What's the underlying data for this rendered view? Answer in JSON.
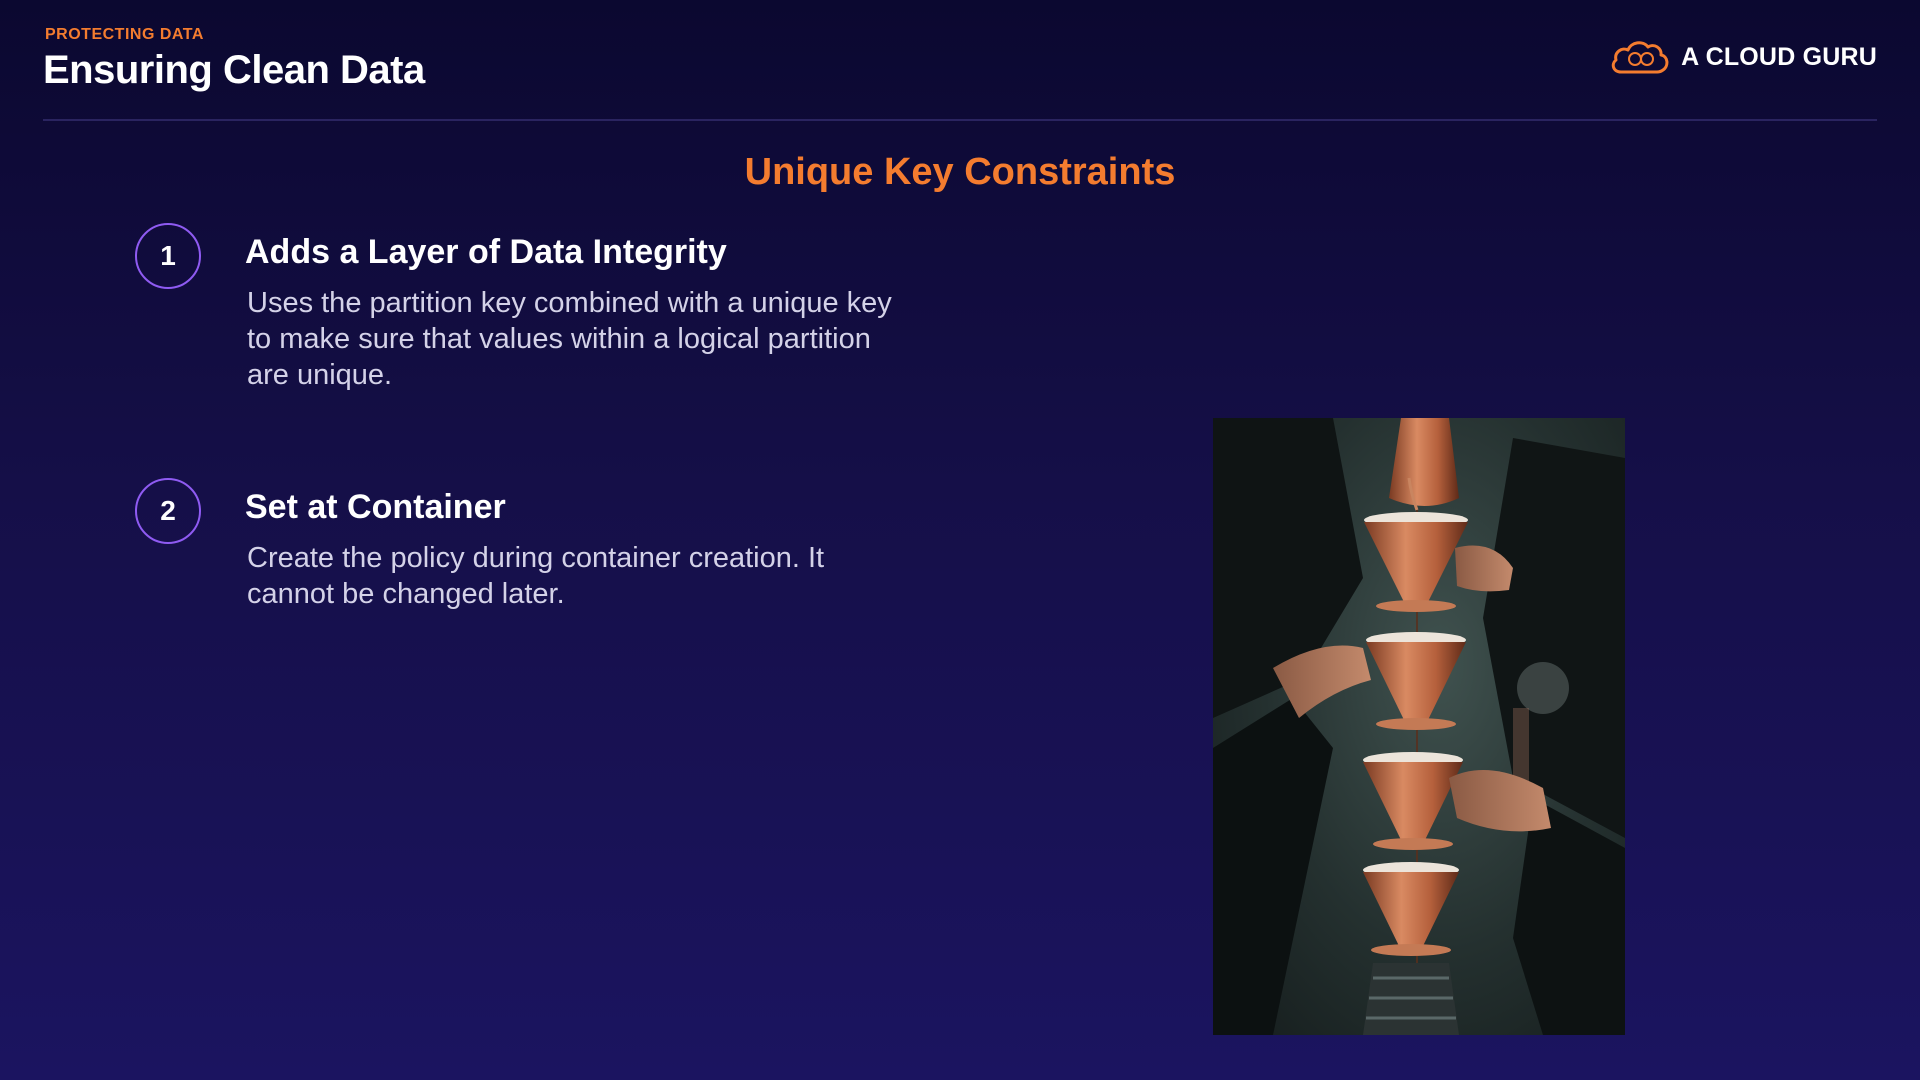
{
  "header": {
    "eyebrow": "PROTECTING DATA",
    "title": "Ensuring Clean Data"
  },
  "logo": {
    "icon": "cloud-icon",
    "text": "A CLOUD GURU"
  },
  "section_title": "Unique Key Constraints",
  "items": [
    {
      "number": "1",
      "heading": "Adds a Layer of Data Integrity",
      "body": "Uses the partition key combined with a unique key to make sure that values within a logical partition are unique."
    },
    {
      "number": "2",
      "heading": "Set at Container",
      "body": "Create the policy during container creation. It cannot be changed later."
    }
  ],
  "colors": {
    "accent_orange": "#f47c2f",
    "circle_purple": "#8f5bf2",
    "background_top": "#0b0830",
    "background_bottom": "#1b1460"
  }
}
